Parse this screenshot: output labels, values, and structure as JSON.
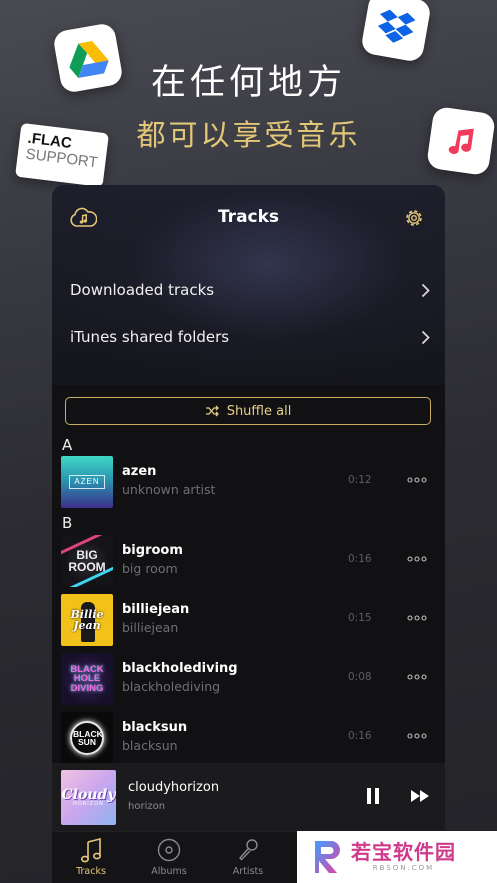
{
  "promo": {
    "headline": "在任何地方",
    "subline": "都可以享受音乐",
    "flac_line1": ".FLAC",
    "flac_line2": "SUPPORT"
  },
  "nav": {
    "title": "Tracks",
    "left_icon": "cloud-music-icon",
    "right_icon": "gear-icon"
  },
  "menu": [
    {
      "label": "Downloaded tracks"
    },
    {
      "label": "iTunes shared folders"
    }
  ],
  "shuffle": {
    "label": "Shuffle all",
    "icon": "shuffle-icon"
  },
  "sections": [
    {
      "letter": "A"
    },
    {
      "letter": "B"
    }
  ],
  "tracks": [
    {
      "title": "azen",
      "artist": "unknown artist",
      "duration": "0:12",
      "cover_text": "AZEN"
    },
    {
      "title": "bigroom",
      "artist": "big room",
      "duration": "0:16",
      "cover_text": "BIG ROOM"
    },
    {
      "title": "billiejean",
      "artist": "billiejean",
      "duration": "0:15",
      "cover_text": "Billie Jean"
    },
    {
      "title": "blackholediving",
      "artist": "blackholediving",
      "duration": "0:08",
      "cover_text": "BLACK HOLE DIVING"
    },
    {
      "title": "blacksun",
      "artist": "blacksun",
      "duration": "0:16",
      "cover_text": "BLACK SUN"
    }
  ],
  "now_playing": {
    "title": "cloudyhorizon",
    "artist": "horizon",
    "cover_text": "Cloudy",
    "cover_subtext": "HORIZON"
  },
  "tabs": [
    {
      "label": "Tracks",
      "icon": "music-note-icon",
      "active": true
    },
    {
      "label": "Albums",
      "icon": "disc-icon",
      "active": false
    },
    {
      "label": "Artists",
      "icon": "microphone-icon",
      "active": false
    }
  ],
  "watermark": {
    "text": "若宝软件园",
    "sub": "RBSON.COM"
  },
  "colors": {
    "accent_gold": "#e3c778",
    "background": "#111113",
    "secondary_text": "#6f6f73"
  }
}
